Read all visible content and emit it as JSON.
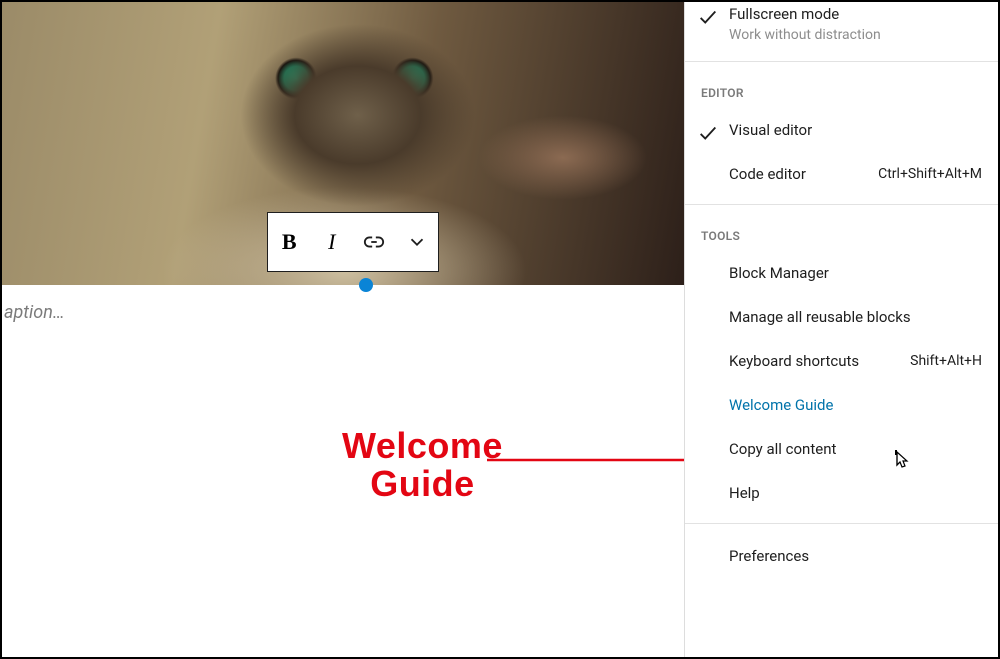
{
  "canvas": {
    "caption_placeholder": "aption…",
    "toolbar": {
      "bold_glyph": "B",
      "italic_glyph": "I"
    }
  },
  "annotation": {
    "line1": "Welcome",
    "line2": "Guide"
  },
  "panel": {
    "view": {
      "fullscreen": {
        "label": "Fullscreen mode",
        "sub": "Work without distraction",
        "checked": true
      }
    },
    "editor": {
      "heading": "EDITOR",
      "visual": {
        "label": "Visual editor",
        "checked": true
      },
      "code": {
        "label": "Code editor",
        "shortcut": "Ctrl+Shift+Alt+M"
      }
    },
    "tools": {
      "heading": "TOOLS",
      "block_manager": {
        "label": "Block Manager"
      },
      "reusable": {
        "label": "Manage all reusable blocks"
      },
      "shortcuts": {
        "label": "Keyboard shortcuts",
        "shortcut": "Shift+Alt+H"
      },
      "welcome": {
        "label": "Welcome Guide"
      },
      "copy_all": {
        "label": "Copy all content"
      },
      "help": {
        "label": "Help"
      }
    },
    "prefs": {
      "label": "Preferences"
    }
  }
}
